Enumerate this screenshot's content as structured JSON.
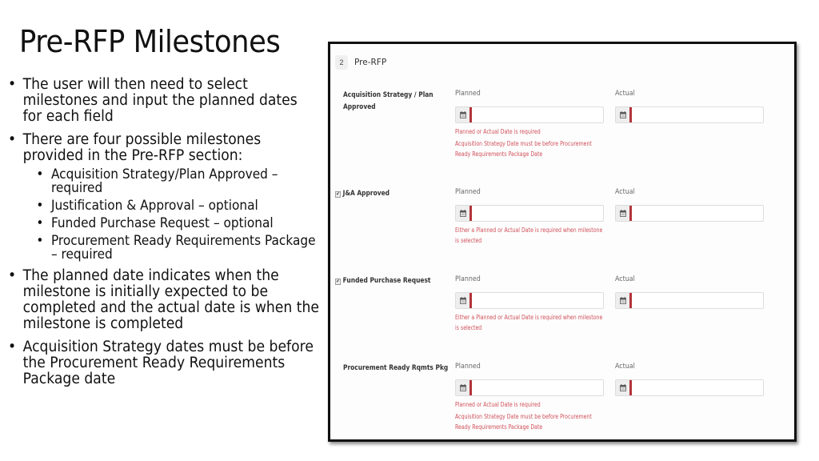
{
  "slide": {
    "title": "Pre-RFP Milestones",
    "bullets": [
      {
        "text": "The user will then need to select milestones and input the planned dates for each field"
      },
      {
        "text": "There are four possible milestones provided in the Pre-RFP section:",
        "sub_items": [
          "Acquisition Strategy/Plan Approved – required",
          "Justification & Approval – optional",
          "Funded Purchase Request – optional",
          "Procurement Ready Requirements Package – required"
        ]
      },
      {
        "text": "The planned date indicates when the milestone is initially expected to be completed and the actual date is when the milestone is completed"
      },
      {
        "text": "Acquisition Strategy dates must be before the Procurement Ready Requirements Package date"
      }
    ],
    "bullet_glyph": "•"
  },
  "form": {
    "section_number": "2",
    "section_title": "Pre-RFP",
    "accent_color": "#b3343a",
    "error_color": "#d0505a",
    "calendar_icon": "calendar-icon",
    "milestones": [
      {
        "label_line1": "Acquisition Strategy / Plan",
        "label_line2": "Approved",
        "has_checkbox": false,
        "planned_label": "Planned",
        "planned_value": "",
        "actual_label": "Actual",
        "actual_value": "",
        "errors": [
          "Planned or Actual Date is required",
          "Acquisition Strategy Date must be before Procurement Ready Requirements Package Date"
        ]
      },
      {
        "label_line1": "J&A Approved",
        "has_checkbox": true,
        "checked": true,
        "checkbox_glyph": "✔",
        "planned_label": "Planned",
        "planned_value": "",
        "actual_label": "Actual",
        "actual_value": "",
        "errors": [
          "Either a Planned or Actual Date is required when milestone is selected"
        ]
      },
      {
        "label_line1": "Funded Purchase Request",
        "has_checkbox": true,
        "checked": true,
        "checkbox_glyph": "✔",
        "planned_label": "Planned",
        "planned_value": "",
        "actual_label": "Actual",
        "actual_value": "",
        "errors": [
          "Either a Planned or Actual Date is required when milestone is selected"
        ]
      },
      {
        "label_line1": "Procurement Ready Rqmts Pkg",
        "has_checkbox": false,
        "planned_label": "Planned",
        "planned_value": "",
        "actual_label": "Actual",
        "actual_value": "",
        "errors": [
          "Planned or Actual Date is required",
          "Acquisition Strategy Date must be before Procurement Ready Requirements Package Date"
        ]
      }
    ]
  }
}
